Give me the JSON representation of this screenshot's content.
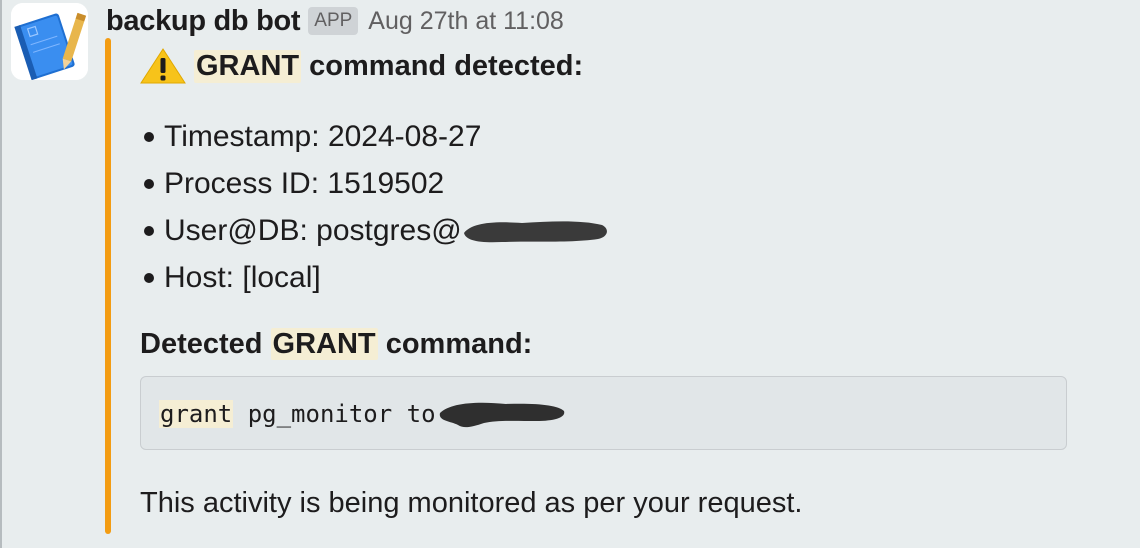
{
  "message": {
    "bot_name": "backup db bot",
    "badge": "APP",
    "timestamp": "Aug 27th at 11:08",
    "attachment_color": "#f39c12",
    "title": {
      "icon": "warning-icon",
      "keyword": "GRANT",
      "rest": " command detected:"
    },
    "details": [
      {
        "label": "Timestamp:",
        "value": "2024-08-27"
      },
      {
        "label": "Process ID:",
        "value": "1519502"
      },
      {
        "label": "User@DB:",
        "value": "postgres@"
      },
      {
        "label": "Host:",
        "value": "[local]"
      }
    ],
    "subtitle": {
      "prefix": "Detected ",
      "keyword": "GRANT",
      "suffix": " command:"
    },
    "code": {
      "keyword": "grant",
      "rest": " pg_monitor to"
    },
    "footer": "This activity is being monitored as per your request."
  }
}
